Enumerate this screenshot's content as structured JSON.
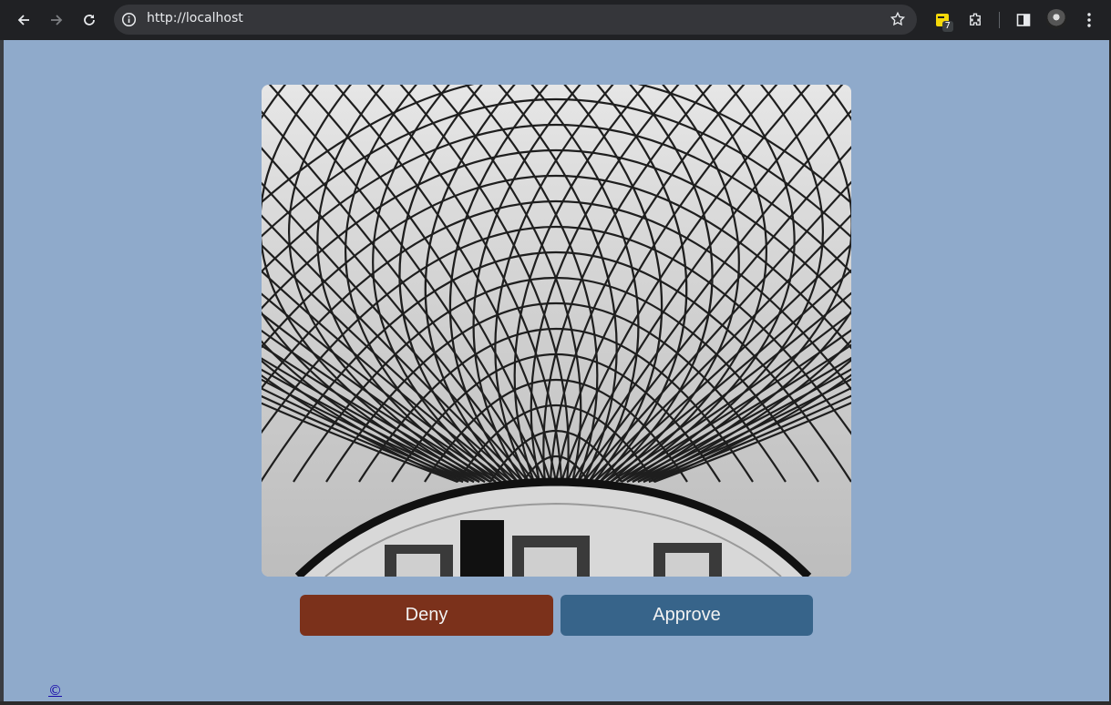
{
  "browser": {
    "url": "http://localhost",
    "extension_badge": "7",
    "icons": {
      "back": "arrow-left-icon",
      "forward": "arrow-right-icon",
      "reload": "reload-icon",
      "site_info": "info-icon",
      "bookmark": "star-icon",
      "extension": "sticky-note-icon",
      "extensions_menu": "puzzle-icon",
      "side_panel": "side-panel-icon",
      "menu": "kebab-menu-icon"
    }
  },
  "page": {
    "background": "#8faacb",
    "image_alt": "Glass lattice roof",
    "deny_label": "Deny",
    "approve_label": "Approve",
    "deny_color": "#7b311b",
    "approve_color": "#37648a",
    "copyright": "©"
  }
}
